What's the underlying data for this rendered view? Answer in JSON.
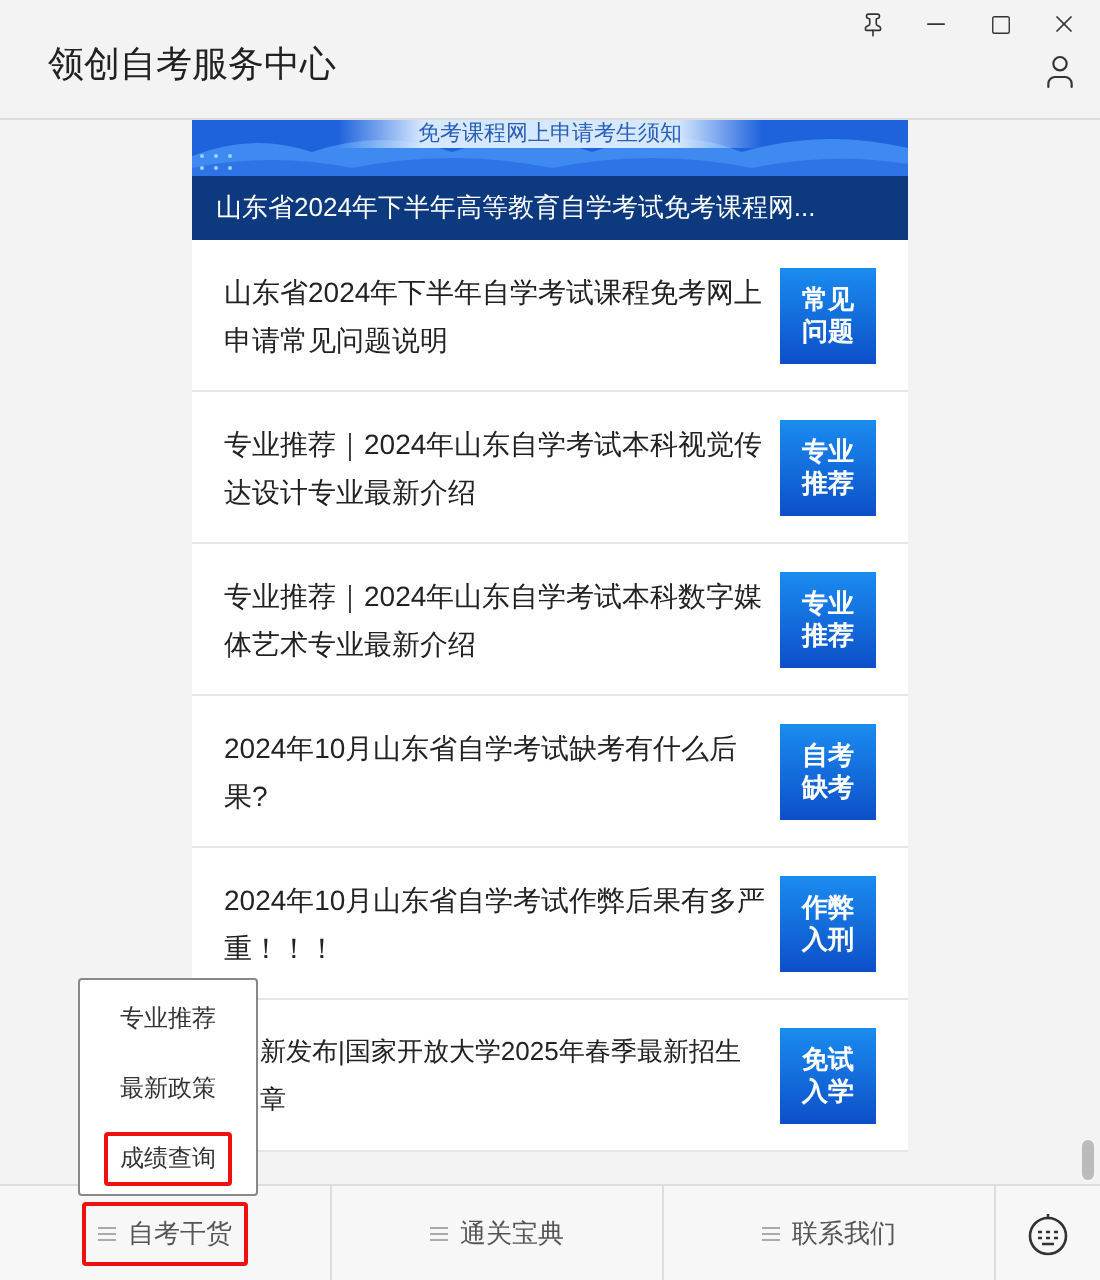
{
  "window": {
    "title": "领创自考服务中心"
  },
  "banner": {
    "subtitle": "免考课程网上申请考生须知",
    "title": "山东省2024年下半年高等教育自学考试免考课程网..."
  },
  "articles": [
    {
      "kind": "full",
      "title": "山东省2024年下半年自学考试课程免考网上申请常见问题说明",
      "thumb": "常见问题"
    },
    {
      "kind": "full",
      "title": "专业推荐｜2024年山东自学考试本科视觉传达设计专业最新介绍",
      "thumb": "专业推荐"
    },
    {
      "kind": "full",
      "title": "专业推荐｜2024年山东自学考试本科数字媒体艺术专业最新介绍",
      "thumb": "专业推荐"
    },
    {
      "kind": "full",
      "title": "2024年10月山东省自学考试缺考有什么后果?",
      "thumb": "自考缺考"
    },
    {
      "kind": "full",
      "title": "2024年10月山东省自学考试作弊后果有多严重！！！",
      "thumb": "作弊入刑"
    },
    {
      "kind": "partial",
      "title_lines": [
        "新发布|国家开放大学2025年春季最新招生",
        "章"
      ],
      "thumb": "免试入学"
    }
  ],
  "popup_menu": [
    {
      "label": "专业推荐",
      "highlighted": false
    },
    {
      "label": "最新政策",
      "highlighted": false
    },
    {
      "label": "成绩查询",
      "highlighted": true
    }
  ],
  "bottom_nav": [
    {
      "label": "自考干货",
      "highlighted": true
    },
    {
      "label": "通关宝典",
      "highlighted": false
    },
    {
      "label": "联系我们",
      "highlighted": false
    }
  ]
}
